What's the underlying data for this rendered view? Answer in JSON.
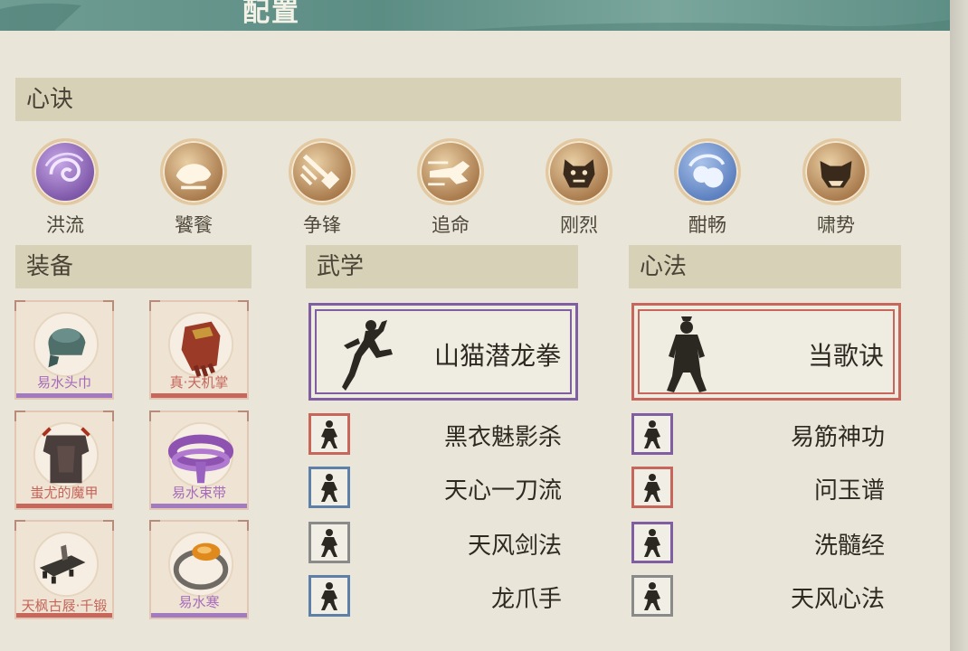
{
  "header": {
    "title": "配置"
  },
  "sections": {
    "xinjue": "心诀",
    "equipment": "装备",
    "martial": "武学",
    "xinfa": "心法"
  },
  "skills": [
    {
      "label": "洪流",
      "icon": "purple-swirl-icon",
      "color": "#8a64b4"
    },
    {
      "label": "饕餮",
      "icon": "taotie-beast-icon",
      "color": "#c9a06a"
    },
    {
      "label": "争锋",
      "icon": "striking-fist-icon",
      "color": "#c9a06a"
    },
    {
      "label": "追命",
      "icon": "dashing-claw-icon",
      "color": "#c9a06a"
    },
    {
      "label": "刚烈",
      "icon": "fierce-tiger-icon",
      "color": "#c9a06a"
    },
    {
      "label": "酣畅",
      "icon": "blue-cloud-icon",
      "color": "#6a8bc4"
    },
    {
      "label": "啸势",
      "icon": "roaring-beast-icon",
      "color": "#c9a06a"
    }
  ],
  "equipment": [
    {
      "name": "易水头巾",
      "icon": "headscarf-icon",
      "rarity_color": "#a27ac0",
      "name_color": "#a56bb8"
    },
    {
      "name": "真·天机掌",
      "icon": "gauntlet-icon",
      "rarity_color": "#c7665a",
      "name_color": "#c4665a"
    },
    {
      "name": "蚩尤的魔甲",
      "icon": "armor-icon",
      "rarity_color": "#c7665a",
      "name_color": "#c4665a"
    },
    {
      "name": "易水束带",
      "icon": "belt-icon",
      "rarity_color": "#a27ac0",
      "name_color": "#a56bb8"
    },
    {
      "name": "天枫古屐·千锻",
      "icon": "clogs-icon",
      "rarity_color": "#c7665a",
      "name_color": "#c4665a"
    },
    {
      "name": "易水寒",
      "icon": "amber-ring-icon",
      "rarity_color": "#a27ac0",
      "name_color": "#a56bb8"
    }
  ],
  "martial": {
    "main": {
      "name": "山猫潜龙拳",
      "color": "#7f5fa2"
    },
    "list": [
      {
        "name": "黑衣魅影杀",
        "color": "#c7665a"
      },
      {
        "name": "天心一刀流",
        "color": "#5d7fa8"
      },
      {
        "name": "天风剑法",
        "color": "#8a8a8a"
      },
      {
        "name": "龙爪手",
        "color": "#5d7fa8"
      }
    ]
  },
  "xinfa": {
    "main": {
      "name": "当歌诀",
      "color": "#c7665a"
    },
    "list": [
      {
        "name": "易筋神功",
        "color": "#7f5fa2"
      },
      {
        "name": "问玉谱",
        "color": "#c7665a"
      },
      {
        "name": "洗髓经",
        "color": "#7f5fa2"
      },
      {
        "name": "天风心法",
        "color": "#8a8a8a"
      }
    ]
  }
}
